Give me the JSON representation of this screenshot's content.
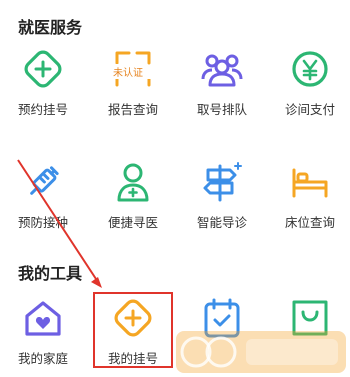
{
  "medical_services": {
    "title": "就医服务",
    "items": [
      {
        "label": "预约挂号",
        "icon": "plus-diamond-icon"
      },
      {
        "label": "报告查询",
        "icon": "report-unverified-icon",
        "badge": "未认证"
      },
      {
        "label": "取号排队",
        "icon": "queue-people-icon"
      },
      {
        "label": "诊间支付",
        "icon": "yuan-payment-icon"
      },
      {
        "label": "预防接种",
        "icon": "syringe-icon"
      },
      {
        "label": "便捷寻医",
        "icon": "doctor-icon"
      },
      {
        "label": "智能导诊",
        "icon": "signpost-icon"
      },
      {
        "label": "床位查询",
        "icon": "bed-icon"
      }
    ]
  },
  "my_tools": {
    "title": "我的工具",
    "items": [
      {
        "label": "我的家庭",
        "icon": "home-heart-icon"
      },
      {
        "label": "我的挂号",
        "icon": "plus-diamond-icon"
      },
      {
        "label": "",
        "icon": "calendar-check-icon"
      },
      {
        "label": "",
        "icon": "shopping-bag-icon"
      }
    ]
  },
  "colors": {
    "green": "#2cb673",
    "orange": "#f5a623",
    "purple": "#6d5fe3",
    "blue": "#3c8fe8",
    "highlight_red": "#e0342b"
  }
}
